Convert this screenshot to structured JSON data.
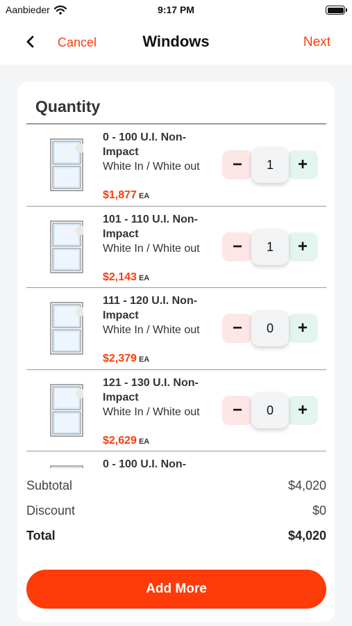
{
  "status_bar": {
    "carrier": "Aanbieder",
    "time": "9:17 PM",
    "battery_level": 1.0
  },
  "nav": {
    "back_icon": "chevron-left-icon",
    "cancel_label": "Cancel",
    "title": "Windows",
    "next_label": "Next"
  },
  "quantity": {
    "title": "Quantity",
    "items": [
      {
        "name": "0 - 100 U.I. Non-Impact",
        "color": "White In / White out",
        "price": "$1,877",
        "unit": "EA",
        "quantity": "1",
        "minus": "−",
        "plus": "+"
      },
      {
        "name": "101 - 110 U.I. Non-Impact",
        "color": "White In / White out",
        "price": "$2,143",
        "unit": "EA",
        "quantity": "1",
        "minus": "−",
        "plus": "+"
      },
      {
        "name": "111 - 120 U.I. Non-Impact",
        "color": "White In / White out",
        "price": "$2,379",
        "unit": "EA",
        "quantity": "0",
        "minus": "−",
        "plus": "+"
      },
      {
        "name": "121 - 130 U.I. Non-Impact",
        "color": "White In / White out",
        "price": "$2,629",
        "unit": "EA",
        "quantity": "0",
        "minus": "−",
        "plus": "+"
      }
    ],
    "partial_item": {
      "name": "0 - 100 U.I. Non-"
    }
  },
  "summary": {
    "subtotal_label": "Subtotal",
    "subtotal_value": "$4,020",
    "discount_label": "Discount",
    "discount_value": "$0",
    "total_label": "Total",
    "total_value": "$4,020"
  },
  "actions": {
    "add_more_label": "Add More"
  },
  "colors": {
    "accent": "#ff3b0a",
    "minus_bg": "#fde6e6",
    "plus_bg": "#e3f5ee",
    "background": "#f4f5f7"
  }
}
